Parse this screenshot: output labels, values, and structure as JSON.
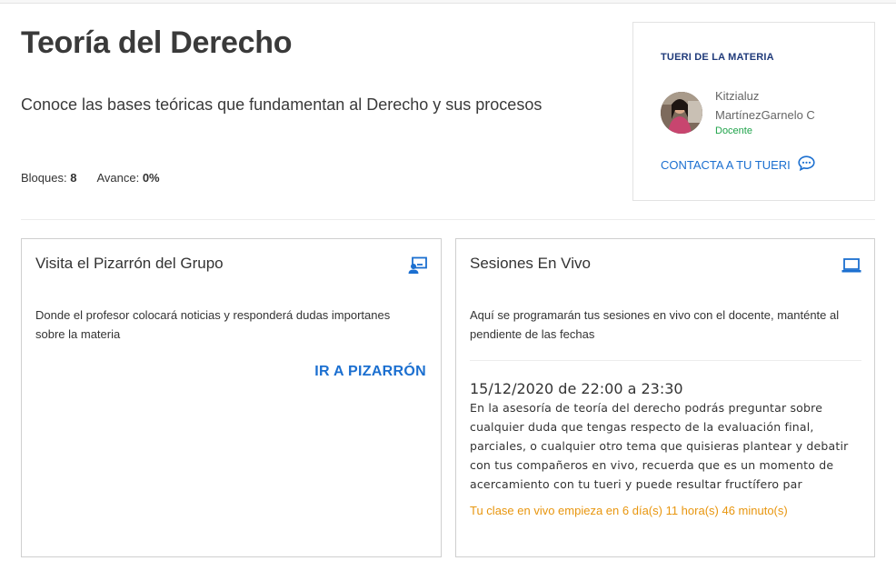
{
  "course": {
    "title": "Teoría del Derecho",
    "description": "Conoce las bases teóricas que fundamentan al Derecho y sus procesos",
    "blocks_label": "Bloques:",
    "blocks_value": "8",
    "progress_label": "Avance:",
    "progress_value": "0%"
  },
  "tutor": {
    "heading": "TUERI DE LA MATERIA",
    "name_first": "Kitzialuz",
    "name_last": "MartínezGarnelo C",
    "role": "Docente",
    "contact_label": "CONTACTA A TU TUERI"
  },
  "board_card": {
    "title": "Visita el Pizarrón del Grupo",
    "text": "Donde el profesor colocará noticias y responderá dudas importanes sobre la materia",
    "link_label": "IR A PIZARRÓN",
    "icon": "board-user-icon"
  },
  "live_card": {
    "title": "Sesiones En Vivo",
    "text": "Aquí se programarán tus sesiones en vivo con el docente, manténte al pendiente de las fechas",
    "icon": "laptop-icon",
    "session": {
      "date": "15/12/2020 de 22:00 a 23:30",
      "description": "En la asesoría de teoría del derecho podrás preguntar sobre cualquier duda que tengas respecto de la evaluación final, parciales, o cualquier otro tema que quisieras plantear y debatir con tus compañeros en vivo, recuerda que es un momento de acercamiento con tu tueri y puede resultar fructífero par",
      "countdown": "Tu clase en vivo empieza en 6 día(s) 11 hora(s) 46 minuto(s)"
    }
  },
  "colors": {
    "accent": "#1b6fd0",
    "tutor_heading": "#1f3a7a",
    "role": "#1fa34a",
    "countdown": "#e8960f"
  }
}
